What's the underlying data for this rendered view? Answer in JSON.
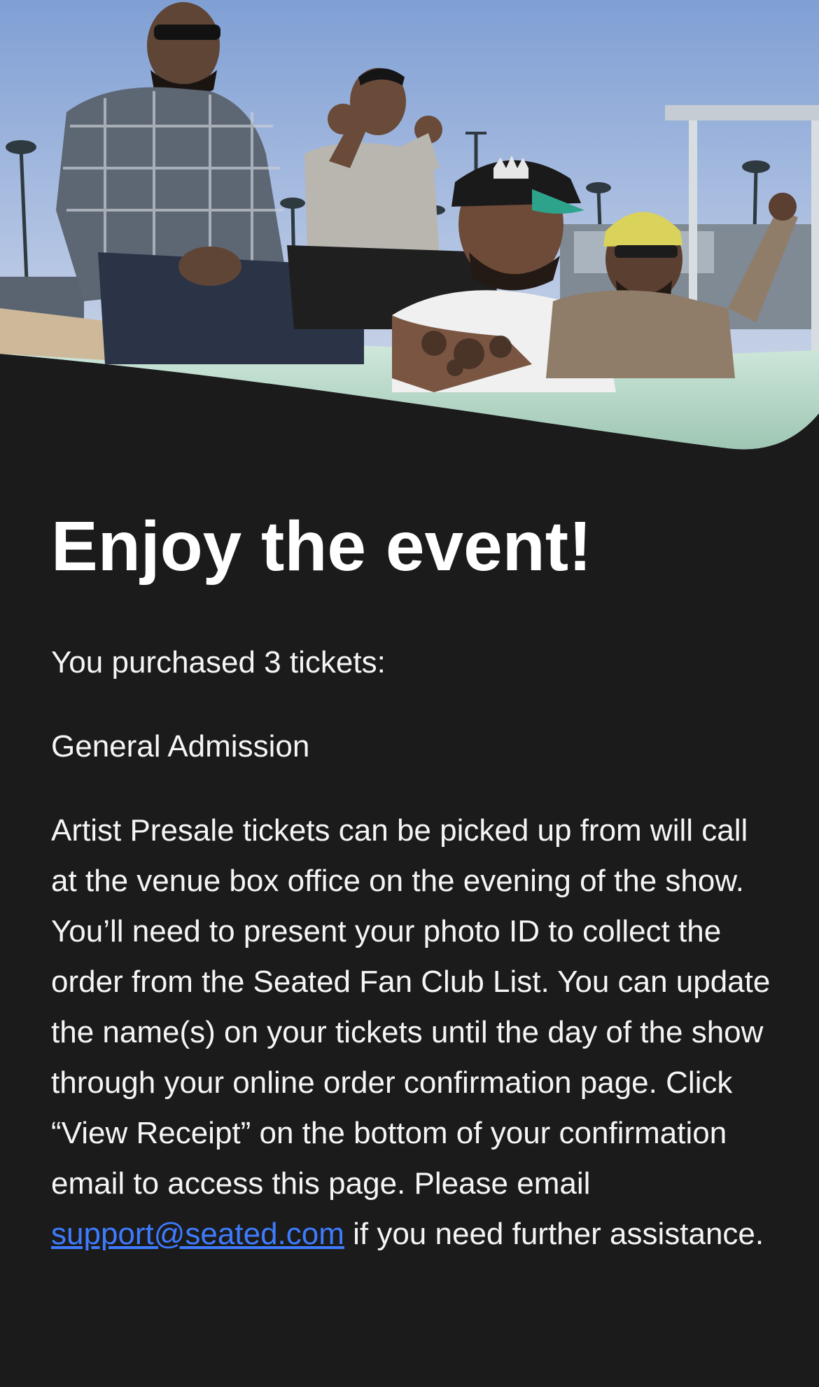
{
  "hero": {
    "image_description_icon": "band-photo-hero-image",
    "hat_logo_icon": "crown-logo-icon"
  },
  "message": {
    "headline": "Enjoy the event!",
    "purchased": "You purchased 3 tickets:",
    "ticket_type": "General Admission",
    "instructions_before_link": "Artist Presale tickets can be picked up from will call at the venue box office on the evening of the show. You’ll need to present your photo ID to collect the order from the Seated Fan Club List. You can update the name(s) on your tickets until the day of the show through your online order confirmation page. Click “View Receipt” on the bottom of your confirmation email to access this page. Please email ",
    "support_email": "support@seated.com",
    "instructions_after_link": " if you need further assistance."
  },
  "colors": {
    "background": "#1b1b1b",
    "text": "#ffffff",
    "link": "#3e7bff",
    "sky": "#8fa8d6",
    "car_mint": "#bfe0cf"
  }
}
